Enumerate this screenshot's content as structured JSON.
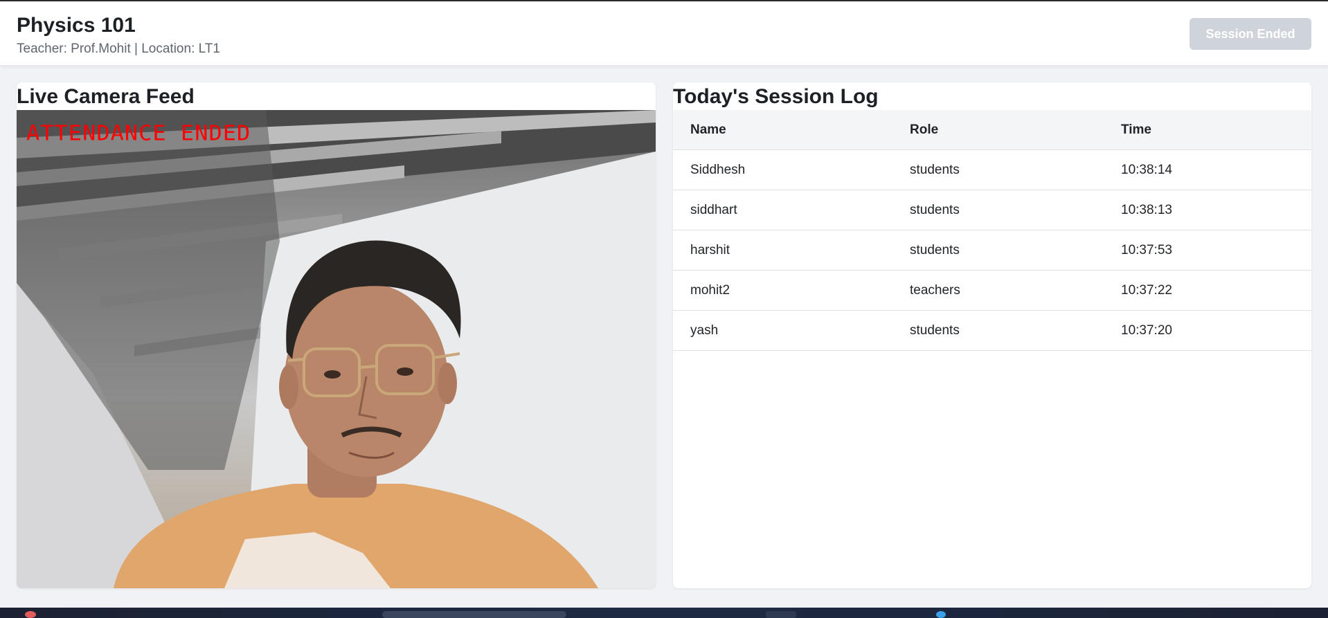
{
  "header": {
    "title": "Physics 101",
    "meta": "Teacher: Prof.Mohit | Location: LT1",
    "session_button": "Session Ended"
  },
  "camera": {
    "title": "Live Camera Feed",
    "overlay_text": "ATTENDANCE ENDED"
  },
  "log": {
    "title": "Today's Session Log",
    "columns": [
      "Name",
      "Role",
      "Time"
    ],
    "rows": [
      [
        "Siddhesh",
        "students",
        "10:38:14"
      ],
      [
        "siddhart",
        "students",
        "10:38:13"
      ],
      [
        "harshit",
        "students",
        "10:37:53"
      ],
      [
        "mohit2",
        "teachers",
        "10:37:22"
      ],
      [
        "yash",
        "students",
        "10:37:20"
      ]
    ]
  },
  "colors": {
    "overlay": "#ff0000",
    "button_disabled": "#ced4da",
    "background": "#f0f2f5"
  }
}
